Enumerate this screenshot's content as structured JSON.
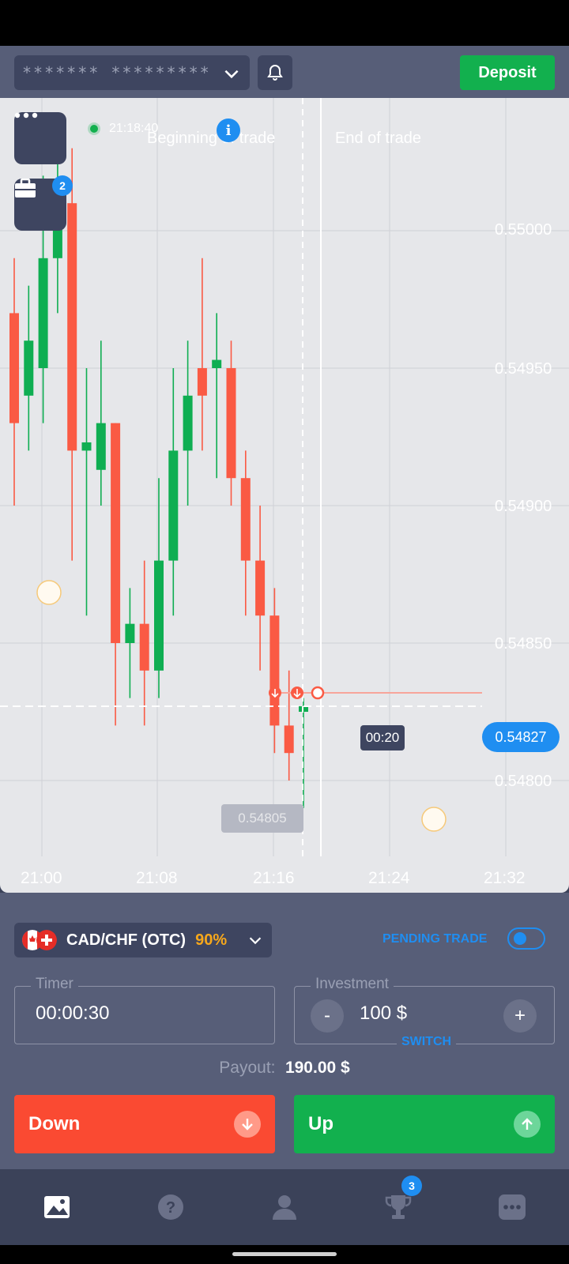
{
  "header": {
    "account_masked": "*******  *********",
    "deposit_label": "Deposit"
  },
  "chart": {
    "server_time": "21:18:40",
    "beginning_label": "Beginning of trade",
    "end_label": "End of trade",
    "portfolio_badge": "2",
    "current_price": "0.54827",
    "countdown": "00:20",
    "low_price_label": "0.54805",
    "y_ticks": [
      "0.55000",
      "0.54950",
      "0.54900",
      "0.54850",
      "0.54800"
    ],
    "x_ticks": [
      "21:00",
      "21:08",
      "21:16",
      "21:24",
      "21:32"
    ],
    "colors": {
      "up": "#0fae52",
      "down": "#fa5a44",
      "accent": "#1f8ef1"
    }
  },
  "chart_data": {
    "type": "candlestick",
    "x_ticks": [
      "21:00",
      "21:08",
      "21:16",
      "21:24",
      "21:32"
    ],
    "y_ticks": [
      0.55,
      0.5495,
      0.549,
      0.5485,
      0.548
    ],
    "ylim": [
      0.5476,
      0.5505
    ],
    "candles": [
      {
        "o": 0.5497,
        "h": 0.5499,
        "l": 0.549,
        "c": 0.5493,
        "d": "down"
      },
      {
        "o": 0.5494,
        "h": 0.5498,
        "l": 0.5492,
        "c": 0.5496,
        "d": "up"
      },
      {
        "o": 0.5495,
        "h": 0.5502,
        "l": 0.5493,
        "c": 0.5499,
        "d": "up"
      },
      {
        "o": 0.5499,
        "h": 0.5503,
        "l": 0.5497,
        "c": 0.5501,
        "d": "up"
      },
      {
        "o": 0.5501,
        "h": 0.5503,
        "l": 0.5488,
        "c": 0.5492,
        "d": "down"
      },
      {
        "o": 0.5492,
        "h": 0.5495,
        "l": 0.5486,
        "c": 0.54923,
        "d": "up"
      },
      {
        "o": 0.54913,
        "h": 0.5496,
        "l": 0.549,
        "c": 0.5493,
        "d": "up"
      },
      {
        "o": 0.5493,
        "h": 0.5493,
        "l": 0.5482,
        "c": 0.5485,
        "d": "down"
      },
      {
        "o": 0.5485,
        "h": 0.5487,
        "l": 0.5483,
        "c": 0.54857,
        "d": "up"
      },
      {
        "o": 0.54857,
        "h": 0.5488,
        "l": 0.5482,
        "c": 0.5484,
        "d": "down"
      },
      {
        "o": 0.5484,
        "h": 0.5491,
        "l": 0.5483,
        "c": 0.5488,
        "d": "up"
      },
      {
        "o": 0.5488,
        "h": 0.5495,
        "l": 0.5486,
        "c": 0.5492,
        "d": "up"
      },
      {
        "o": 0.5492,
        "h": 0.5496,
        "l": 0.549,
        "c": 0.5494,
        "d": "up"
      },
      {
        "o": 0.5494,
        "h": 0.5499,
        "l": 0.5492,
        "c": 0.5495,
        "d": "down"
      },
      {
        "o": 0.5495,
        "h": 0.5497,
        "l": 0.5491,
        "c": 0.54953,
        "d": "up"
      },
      {
        "o": 0.5495,
        "h": 0.5496,
        "l": 0.549,
        "c": 0.5491,
        "d": "down"
      },
      {
        "o": 0.5491,
        "h": 0.5492,
        "l": 0.5486,
        "c": 0.5488,
        "d": "down"
      },
      {
        "o": 0.5488,
        "h": 0.549,
        "l": 0.5484,
        "c": 0.5486,
        "d": "down"
      },
      {
        "o": 0.5486,
        "h": 0.5487,
        "l": 0.5481,
        "c": 0.5482,
        "d": "down"
      },
      {
        "o": 0.5482,
        "h": 0.5484,
        "l": 0.548,
        "c": 0.5481,
        "d": "down"
      },
      {
        "o": 0.54827,
        "h": 0.5483,
        "l": 0.5479,
        "c": 0.54825,
        "d": "up"
      }
    ],
    "current_price": 0.54827
  },
  "trade_panel": {
    "asset_name": "CAD/CHF (OTC)",
    "asset_payout": "90%",
    "pending_label": "PENDING TRADE",
    "timer_legend": "Timer",
    "timer_value": "00:00:30",
    "investment_legend": "Investment",
    "investment_value": "100 $",
    "minus_label": "-",
    "plus_label": "+",
    "switch_label": "SWITCH",
    "payout_label": "Payout:",
    "payout_value": "190.00 $",
    "down_label": "Down",
    "up_label": "Up"
  },
  "nav": {
    "tournaments_badge": "3",
    "items": [
      "chart-icon",
      "help-icon",
      "profile-icon",
      "trophy-icon",
      "chat-icon"
    ]
  }
}
